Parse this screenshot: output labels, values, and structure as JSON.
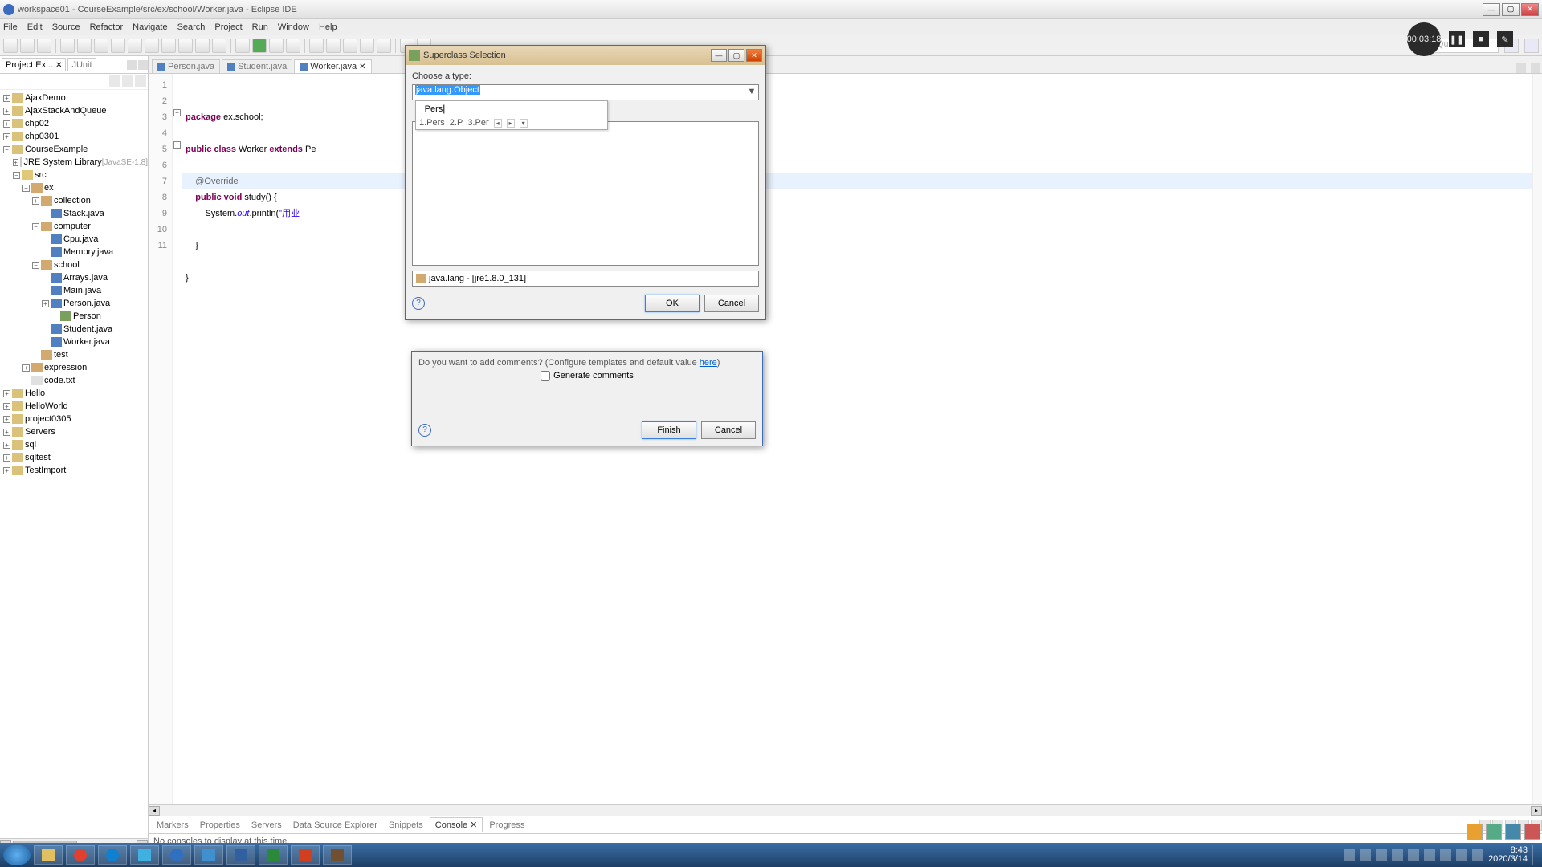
{
  "titlebar": "workspace01 - CourseExample/src/ex/school/Worker.java - Eclipse IDE",
  "menu": [
    "File",
    "Edit",
    "Source",
    "Refactor",
    "Navigate",
    "Search",
    "Project",
    "Run",
    "Window",
    "Help"
  ],
  "quick_access": "Qu",
  "sidebar": {
    "tabs": {
      "pkg": "Project Ex...",
      "junit": "JUnit"
    },
    "tree": [
      {
        "d": 0,
        "t": "▸",
        "i": "proj",
        "l": "AjaxDemo"
      },
      {
        "d": 0,
        "t": "▸",
        "i": "proj",
        "l": "AjaxStackAndQueue"
      },
      {
        "d": 0,
        "t": "▸",
        "i": "proj",
        "l": "chp02"
      },
      {
        "d": 0,
        "t": "▸",
        "i": "proj",
        "l": "chp0301"
      },
      {
        "d": 0,
        "t": "▾",
        "i": "proj",
        "l": "CourseExample"
      },
      {
        "d": 1,
        "t": "▸",
        "i": "jar",
        "l": "JRE System Library ",
        "ex": "[JavaSE-1.8]"
      },
      {
        "d": 1,
        "t": "▾",
        "i": "fold",
        "l": "src"
      },
      {
        "d": 2,
        "t": "▾",
        "i": "pkg",
        "l": "ex"
      },
      {
        "d": 3,
        "t": "▸",
        "i": "pkg",
        "l": "collection"
      },
      {
        "d": 4,
        "t": "",
        "i": "java",
        "l": "Stack.java"
      },
      {
        "d": 3,
        "t": "▾",
        "i": "pkg",
        "l": "computer"
      },
      {
        "d": 4,
        "t": "",
        "i": "java",
        "l": "Cpu.java"
      },
      {
        "d": 4,
        "t": "",
        "i": "java",
        "l": "Memory.java"
      },
      {
        "d": 3,
        "t": "▾",
        "i": "pkg",
        "l": "school"
      },
      {
        "d": 4,
        "t": "",
        "i": "java",
        "l": "Arrays.java"
      },
      {
        "d": 4,
        "t": "",
        "i": "java",
        "l": "Main.java"
      },
      {
        "d": 4,
        "t": "▸",
        "i": "java",
        "l": "Person.java"
      },
      {
        "d": 5,
        "t": "",
        "i": "cls",
        "l": "Person"
      },
      {
        "d": 4,
        "t": "",
        "i": "java",
        "l": "Student.java"
      },
      {
        "d": 4,
        "t": "",
        "i": "java",
        "l": "Worker.java"
      },
      {
        "d": 3,
        "t": "",
        "i": "pkg",
        "l": "test"
      },
      {
        "d": 2,
        "t": "▸",
        "i": "pkg",
        "l": "expression"
      },
      {
        "d": 2,
        "t": "",
        "i": "txt",
        "l": "code.txt"
      },
      {
        "d": 0,
        "t": "▸",
        "i": "proj",
        "l": "Hello"
      },
      {
        "d": 0,
        "t": "▸",
        "i": "proj",
        "l": "HelloWorld"
      },
      {
        "d": 0,
        "t": "▸",
        "i": "proj",
        "l": "project0305"
      },
      {
        "d": 0,
        "t": "▸",
        "i": "proj",
        "l": "Servers"
      },
      {
        "d": 0,
        "t": "▸",
        "i": "proj",
        "l": "sql"
      },
      {
        "d": 0,
        "t": "▸",
        "i": "proj",
        "l": "sqltest"
      },
      {
        "d": 0,
        "t": "▸",
        "i": "proj",
        "l": "TestImport"
      }
    ]
  },
  "editor": {
    "tabs": [
      {
        "label": "Person.java",
        "active": false
      },
      {
        "label": "Student.java",
        "active": false
      },
      {
        "label": "Worker.java",
        "active": true
      }
    ],
    "lines": [
      "1",
      "2",
      "3",
      "4",
      "5",
      "6",
      "7",
      "8",
      "9",
      "10",
      "11"
    ]
  },
  "bottom": {
    "tabs": [
      "Markers",
      "Properties",
      "Servers",
      "Data Source Explorer",
      "Snippets",
      "Console",
      "Progress"
    ],
    "active": 5,
    "msg": "No consoles to display at this time."
  },
  "dialog_super": {
    "title": "Superclass Selection",
    "choose": "Choose a type:",
    "input_sel": "java.lang.Object",
    "ime_text": "Pers",
    "ime_cand": [
      "1.Pers",
      "2.P",
      "3.Per"
    ],
    "status": "java.lang - [jre1.8.0_131]",
    "ok": "OK",
    "cancel": "Cancel"
  },
  "dialog_new": {
    "comment_q": "Do you want to add comments? (Configure templates and default value ",
    "here": "here",
    "gen": "Generate comments",
    "finish": "Finish",
    "cancel": "Cancel"
  },
  "recorder": {
    "time": "00:03:18"
  },
  "clock": {
    "time": "8:43",
    "date": "2020/3/14"
  }
}
